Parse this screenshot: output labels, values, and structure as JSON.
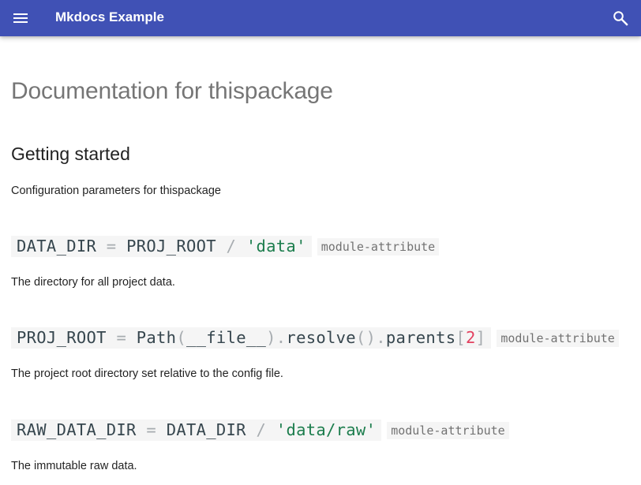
{
  "header": {
    "title": "Mkdocs Example",
    "bg_color": "#4051b5",
    "menu_icon": "hamburger-menu-icon",
    "search_icon": "search-icon"
  },
  "page": {
    "title": "Documentation for thispackage",
    "section_title": "Getting started",
    "intro": "Configuration parameters for thispackage"
  },
  "attributes": [
    {
      "name": "DATA_DIR",
      "op": "=",
      "parts": [
        "PROJ_ROOT",
        "/",
        "'data'"
      ],
      "label": "module-attribute",
      "description": "The directory for all project data."
    },
    {
      "name": "PROJ_ROOT",
      "op": "=",
      "parts": [
        "Path",
        "(",
        "__file__",
        ").",
        "resolve",
        "().",
        "parents",
        "[",
        "2",
        "]"
      ],
      "label": "module-attribute",
      "description": "The project root directory set relative to the config file."
    },
    {
      "name": "RAW_DATA_DIR",
      "op": "=",
      "parts": [
        "DATA_DIR",
        "/",
        "'data/raw'"
      ],
      "label": "module-attribute",
      "description": "The immutable raw data."
    }
  ]
}
